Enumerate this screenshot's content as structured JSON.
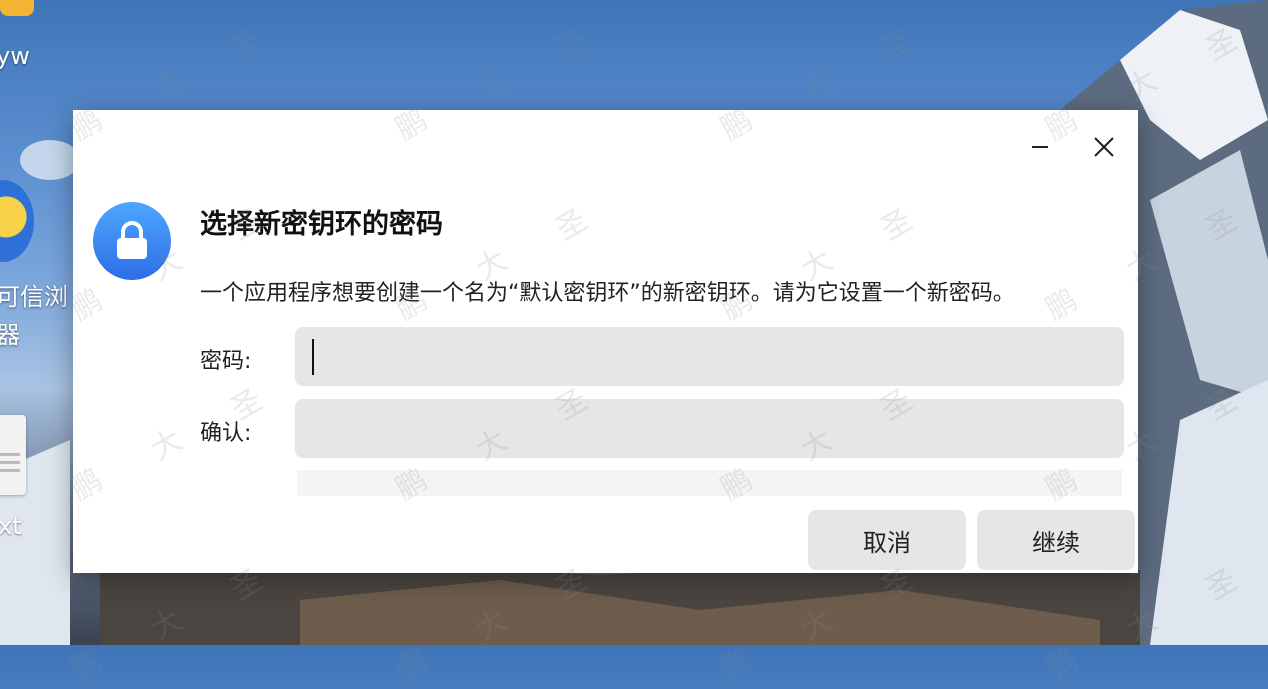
{
  "desktop": {
    "icons": [
      {
        "label": "yw"
      },
      {
        "label": "可信浏\n器"
      },
      {
        "label": "xt"
      }
    ]
  },
  "watermark": {
    "text": "鹏大圣"
  },
  "dialog": {
    "title": "选择新密钥环的密码",
    "description": "一个应用程序想要创建一个名为“默认密钥环”的新密钥环。请为它设置一个新密码。",
    "password_label": "密码:",
    "password_value": "",
    "confirm_label": "确认:",
    "confirm_value": "",
    "cancel_label": "取消",
    "continue_label": "继续",
    "icon": "lock-icon"
  }
}
